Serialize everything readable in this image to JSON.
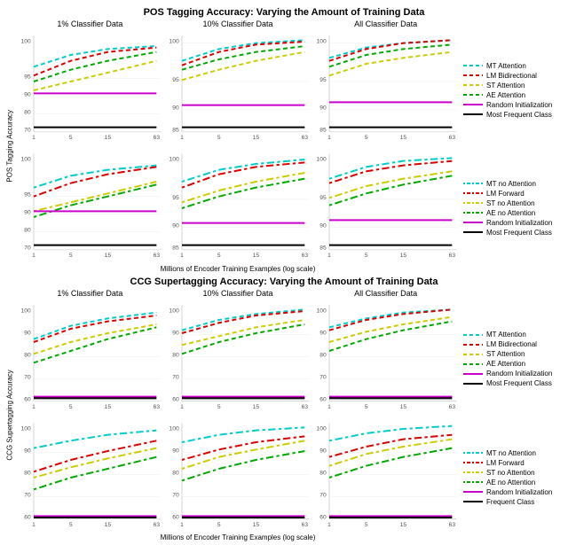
{
  "pos_title": "POS Tagging Accuracy: Varying the Amount of Training Data",
  "ccg_title": "CCG Supertagging Accuracy: Varying the Amount of Training Data",
  "col_titles": [
    "1% Classifier Data",
    "10% Classifier Data",
    "All Classifier Data"
  ],
  "x_axis_label": "Millions of Encoder Training Examples (log scale)",
  "pos_y_label": "POS Tagging Accuracy",
  "ccg_y_label": "CCG Supertagging Accuracy",
  "x_ticks": [
    "1",
    "5",
    "15",
    "63"
  ],
  "legend_attention": [
    {
      "label": "MT Attention",
      "color": "#00CCCC",
      "style": "dashed"
    },
    {
      "label": "LM Bidirectional",
      "color": "#DD0000",
      "style": "dashed"
    },
    {
      "label": "ST Attention",
      "color": "#CCCC00",
      "style": "dashed"
    },
    {
      "label": "AE Attention",
      "color": "#00AA00",
      "style": "dashed"
    },
    {
      "label": "Random Initialization",
      "color": "#CC00CC",
      "style": "solid"
    },
    {
      "label": "Most Frequent Class",
      "color": "#000000",
      "style": "solid"
    }
  ],
  "legend_no_attention": [
    {
      "label": "MT no Attention",
      "color": "#00CCCC",
      "style": "dotdash"
    },
    {
      "label": "LM Forward",
      "color": "#DD0000",
      "style": "dotdash"
    },
    {
      "label": "ST no Attention",
      "color": "#CCCC00",
      "style": "dotdash"
    },
    {
      "label": "AE no Attention",
      "color": "#00AA00",
      "style": "dotdash"
    },
    {
      "label": "Random Initialization",
      "color": "#CC00CC",
      "style": "solid"
    },
    {
      "label": "Most Frequent Class",
      "color": "#000000",
      "style": "solid"
    }
  ]
}
